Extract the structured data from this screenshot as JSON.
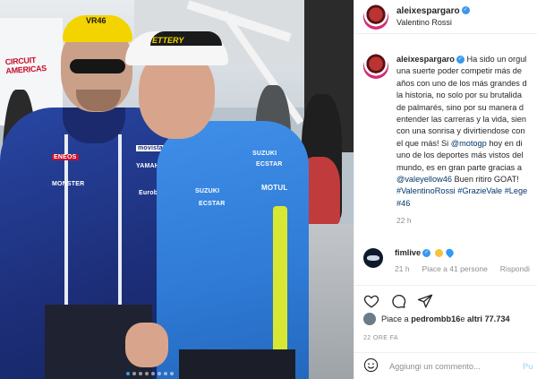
{
  "photo": {
    "banner_text": "CIRCUIT AMERICAS",
    "rossi_cap_text": "VR46",
    "aleix_cap_text": "ETTERY",
    "sponsors": {
      "rossi_monster": "MONSTER",
      "rossi_yamaha": "YAMAHA",
      "rossi_movistar": "movistar",
      "rossi_eneos": "ENEOS",
      "rossi_bank": "Eurobank",
      "aleix_suzuki": "SUZUKI",
      "aleix_ecstar": "ECSTAR",
      "aleix_motul": "MOTUL",
      "aleix_chest": "SUZUKI",
      "aleix_chest2": "ECSTAR"
    },
    "carousel": {
      "count": 8,
      "active_index": 0
    }
  },
  "header": {
    "username": "aleixespargaro",
    "location": "Valentino Rossi"
  },
  "caption": {
    "username": "aleixespargaro",
    "lines": [
      "Ha sido un orgul",
      "una suerte poder competir más de",
      "años con uno de los más grandes d",
      "la historia, no solo por su brutalida",
      "de palmarés, sino por su manera d",
      "entender las carreras y la vida, sien",
      "con una sonrisa y divirtiendose con",
      "el que más! Si ",
      "uno de los deportes más vistos del",
      "mundo, es en gran parte gracias a",
      "",
      ""
    ],
    "mention_motogp": "@motogp",
    "line8_tail": " hoy en di",
    "mention_vale": "@valeyellow46",
    "line11_tail": " Buen ritiro GOAT!",
    "hashtags_line": "#ValentinoRossi #GrazieVale #Lege",
    "hashtag_46": "#46",
    "time": "22 h"
  },
  "reply": {
    "username": "fimlive",
    "time": "21 h",
    "likes": "Piace a 41 persone",
    "reply_label": "Rispondi"
  },
  "likes": {
    "prefix": "Piace a ",
    "user": "pedrombb16",
    "middle": " e ",
    "count": "altri 77.734"
  },
  "post_time": "22 ORE FA",
  "comment": {
    "placeholder": "Aggiungi un commento...",
    "publish": "Pu"
  }
}
